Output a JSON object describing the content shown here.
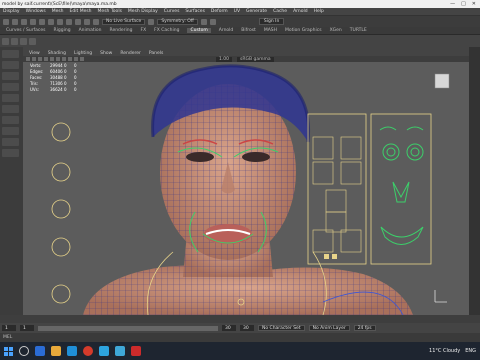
{
  "window": {
    "title": "model by saif.current\\(ScE\\file)\\maya\\maya.ma.mb",
    "controls": [
      "—",
      "□",
      "✕"
    ]
  },
  "menubar": [
    "Display",
    "Windows",
    "Mesh",
    "Edit Mesh",
    "Mesh Tools",
    "Mesh Display",
    "Curves",
    "Surfaces",
    "Deform",
    "UV",
    "Generate",
    "Cache",
    "Arnold",
    "Help"
  ],
  "toolbar": {
    "live_surface": "No Live Surface",
    "symmetry": "Symmetry: Off",
    "sign_in": "Sign In"
  },
  "shelf_tabs": [
    "Curves / Surfaces",
    "Rigging",
    "Animation",
    "Rendering",
    "FX",
    "FX Caching",
    "Custom",
    "Arnold",
    "Bifrost",
    "MASH",
    "Motion Graphics",
    "XGen",
    "TURTLE"
  ],
  "active_shelf_tab": "Custom",
  "panel_menu": [
    "View",
    "Shading",
    "Lighting",
    "Show",
    "Renderer",
    "Panels"
  ],
  "panel_toolbar": {
    "gamma": "1.00",
    "colorspace": "sRGB gamma"
  },
  "hud": {
    "rows": [
      {
        "label": "Verts:",
        "a": "29944",
        "b": "0",
        "c": "0"
      },
      {
        "label": "Edges:",
        "a": "60406",
        "b": "0",
        "c": "0"
      },
      {
        "label": "Faces:",
        "a": "30488",
        "b": "0",
        "c": "0"
      },
      {
        "label": "Tris:",
        "a": "71306",
        "b": "0",
        "c": "0"
      },
      {
        "label": "UVs:",
        "a": "36624",
        "b": "0",
        "c": "0"
      }
    ]
  },
  "timeline": {
    "start": "1",
    "current": "1",
    "end": "30",
    "range_end": "30",
    "character_set": "No Character Set",
    "anim_layer": "No Anim Layer",
    "fps": "24 fps"
  },
  "command_line": {
    "mel": "MEL"
  },
  "taskbar": {
    "weather": "11°C  Cloudy",
    "tray": "ENG"
  },
  "colors": {
    "wire": "#2b2d8a",
    "skin": "#c98f79",
    "controls": "#e8d48a",
    "green": "#3ccf6a"
  }
}
